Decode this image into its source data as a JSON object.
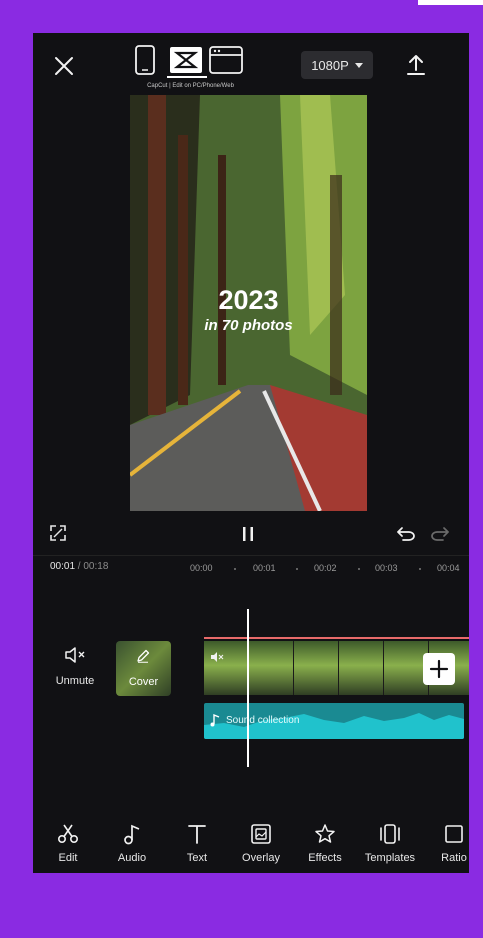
{
  "topbar": {
    "device_caption": "CapCut | Edit on PC/Phone/Web",
    "resolution": "1080P"
  },
  "preview": {
    "headline_year": "2023",
    "headline_sub": "in 70 photos"
  },
  "timeline": {
    "current_time": "00:01",
    "separator": " / ",
    "total_time": "00:18",
    "ruler": [
      "00:00",
      "00:01",
      "00:02",
      "00:03",
      "00:04"
    ]
  },
  "tracks": {
    "mute_label": "Unmute",
    "cover_label": "Cover",
    "audio_label": "Sound collection"
  },
  "toolbar": {
    "items": [
      {
        "label": "Edit",
        "icon": "scissors-icon"
      },
      {
        "label": "Audio",
        "icon": "music-note-icon"
      },
      {
        "label": "Text",
        "icon": "text-icon"
      },
      {
        "label": "Overlay",
        "icon": "overlay-icon"
      },
      {
        "label": "Effects",
        "icon": "effects-icon"
      },
      {
        "label": "Templates",
        "icon": "templates-icon"
      },
      {
        "label": "Ratio",
        "icon": "ratio-icon"
      }
    ]
  },
  "colors": {
    "background": "#8a2be2",
    "app": "#111114",
    "audio_track": "#1a8a92",
    "clip_border": "#e86a6a"
  }
}
